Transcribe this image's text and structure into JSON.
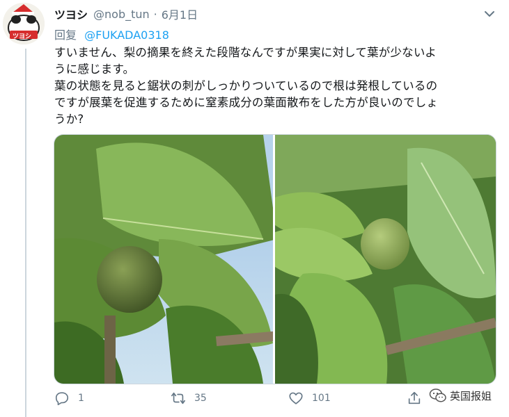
{
  "tweet": {
    "display_name": "ツヨシ",
    "handle": "@nob_tun",
    "separator": "·",
    "date": "6月1日",
    "reply_prefix": "回复",
    "reply_to": "@FUKADA0318",
    "text_lines": [
      "すいません、梨の摘果を終えた段階なんですが果実に対して葉が少ないよ",
      "うに感じます。",
      "葉の状態を見ると鋸状の刺がしっかりついているので根は発根しているの",
      "ですが展葉を促進するために窒素成分の葉面散布をした方が良いのでしょ",
      "うか?"
    ]
  },
  "avatar": {
    "text": "ツヨシ"
  },
  "actions": {
    "reply_count": "1",
    "retweet_count": "35",
    "like_count": "101"
  },
  "watermark": {
    "text": "英国报姐"
  },
  "icons": {
    "caret": "chevron-down-icon",
    "reply": "reply-icon",
    "retweet": "retweet-icon",
    "like": "heart-icon",
    "share": "share-icon"
  },
  "colors": {
    "link": "#1da1f2",
    "secondary_text": "#657786",
    "thread_line": "#ccd6dd"
  }
}
